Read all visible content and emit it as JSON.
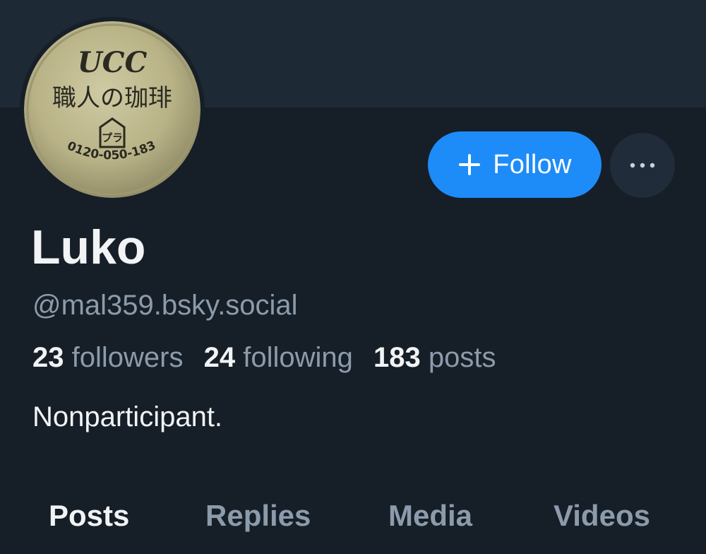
{
  "profile": {
    "display_name": "Luko",
    "handle": "@mal359.bsky.social",
    "bio": "Nonparticipant.",
    "avatar": {
      "brand": "UCC",
      "subtitle": "職人の珈琲",
      "phone": "0120-050-183",
      "recycle_mark": "プラ"
    }
  },
  "stats": {
    "followers_count": "23",
    "followers_label": "followers",
    "following_count": "24",
    "following_label": "following",
    "posts_count": "183",
    "posts_label": "posts"
  },
  "actions": {
    "follow_label": "Follow",
    "more_icon": "ellipsis-icon"
  },
  "tabs": [
    {
      "label": "Posts",
      "active": true
    },
    {
      "label": "Replies",
      "active": false
    },
    {
      "label": "Media",
      "active": false
    },
    {
      "label": "Videos",
      "active": false
    }
  ],
  "colors": {
    "background": "#161e27",
    "banner": "#1e2936",
    "accent": "#1d8cf8",
    "muted_text": "#8c9bab"
  }
}
